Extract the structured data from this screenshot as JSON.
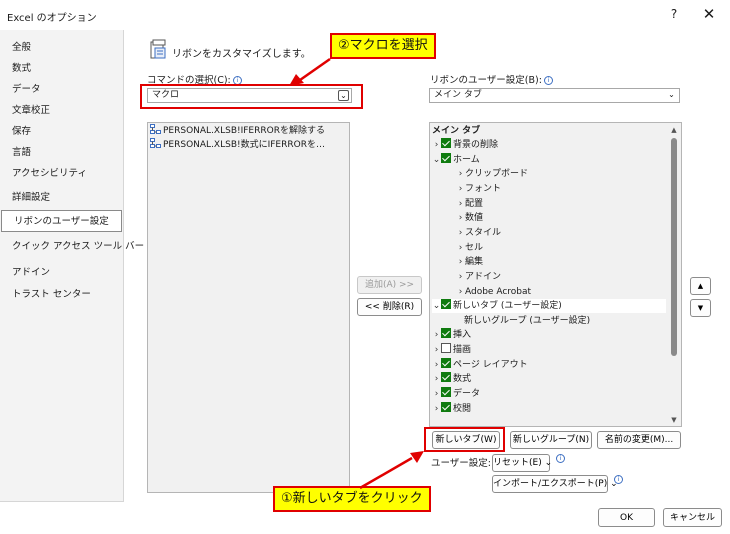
{
  "window": {
    "title": "Excel のオプション",
    "help_label": "?",
    "close_label": "✕",
    "help_icon": "question-mark-icon",
    "close_icon": "close-icon"
  },
  "nav": {
    "items": [
      {
        "label": "全般"
      },
      {
        "label": "数式"
      },
      {
        "label": "データ"
      },
      {
        "label": "文章校正"
      },
      {
        "label": "保存"
      },
      {
        "label": "言語"
      },
      {
        "label": "アクセシビリティ"
      },
      {
        "label": "詳細設定"
      },
      {
        "label": "リボンのユーザー設定",
        "selected": true
      },
      {
        "label": "クイック アクセス ツール バー"
      },
      {
        "label": "アドイン"
      },
      {
        "label": "トラスト センター"
      }
    ]
  },
  "header": {
    "text": "リボンをカスタマイズします。",
    "icon": "ribbon-customize-icon"
  },
  "commands": {
    "label": "コマンドの選択(C):",
    "value": "マクロ",
    "items": [
      "PERSONAL.XLSB!IFERRORを解除する",
      "PERSONAL.XLSB!数式にIFERRORを…"
    ]
  },
  "ribbon_settings": {
    "label": "リボンのユーザー設定(B):",
    "value": "メイン タブ"
  },
  "tree": {
    "header": "メイン タブ",
    "rows": [
      {
        "indent": 0,
        "chevron": "›",
        "checked": true,
        "label": "背景の削除"
      },
      {
        "indent": 0,
        "chevron": "⌄",
        "checked": true,
        "label": "ホーム"
      },
      {
        "indent": 1,
        "chevron": "›",
        "label": "クリップボード"
      },
      {
        "indent": 1,
        "chevron": "›",
        "label": "フォント"
      },
      {
        "indent": 1,
        "chevron": "›",
        "label": "配置"
      },
      {
        "indent": 1,
        "chevron": "›",
        "label": "数値"
      },
      {
        "indent": 1,
        "chevron": "›",
        "label": "スタイル"
      },
      {
        "indent": 1,
        "chevron": "›",
        "label": "セル"
      },
      {
        "indent": 1,
        "chevron": "›",
        "label": "編集"
      },
      {
        "indent": 1,
        "chevron": "›",
        "label": "アドイン"
      },
      {
        "indent": 1,
        "chevron": "›",
        "label": "Adobe Acrobat"
      },
      {
        "indent": 0,
        "chevron": "⌄",
        "checked": true,
        "label": "新しいタブ (ユーザー設定)",
        "selected": true
      },
      {
        "indent": 2,
        "chevron": "",
        "label": "新しいグループ (ユーザー設定)"
      },
      {
        "indent": 0,
        "chevron": "›",
        "checked": true,
        "label": "挿入"
      },
      {
        "indent": 0,
        "chevron": "›",
        "checked": false,
        "label": "描画"
      },
      {
        "indent": 0,
        "chevron": "›",
        "checked": true,
        "label": "ページ レイアウト"
      },
      {
        "indent": 0,
        "chevron": "›",
        "checked": true,
        "label": "数式"
      },
      {
        "indent": 0,
        "chevron": "›",
        "checked": true,
        "label": "データ"
      },
      {
        "indent": 0,
        "chevron": "›",
        "checked": true,
        "label": "校閲"
      }
    ]
  },
  "buttons": {
    "add": "追加(A) >>",
    "remove": "<< 削除(R)",
    "move_up": "▲",
    "move_down": "▼",
    "new_tab": "新しいタブ(W)",
    "new_group": "新しいグループ(N)",
    "rename": "名前の変更(M)...",
    "customize_label": "ユーザー設定:",
    "reset": "リセット(E) ⌄",
    "import_export": "インポート/エクスポート(P) ⌄",
    "ok": "OK",
    "cancel": "キャンセル"
  },
  "annotations": {
    "step2": "②マクロを選択",
    "step1": "①新しいタブをクリック",
    "color": "#e00000",
    "highlight": "#ffff00"
  },
  "colors": {
    "checkbox": "#0f7b0f",
    "info": "#3d6fc2"
  }
}
